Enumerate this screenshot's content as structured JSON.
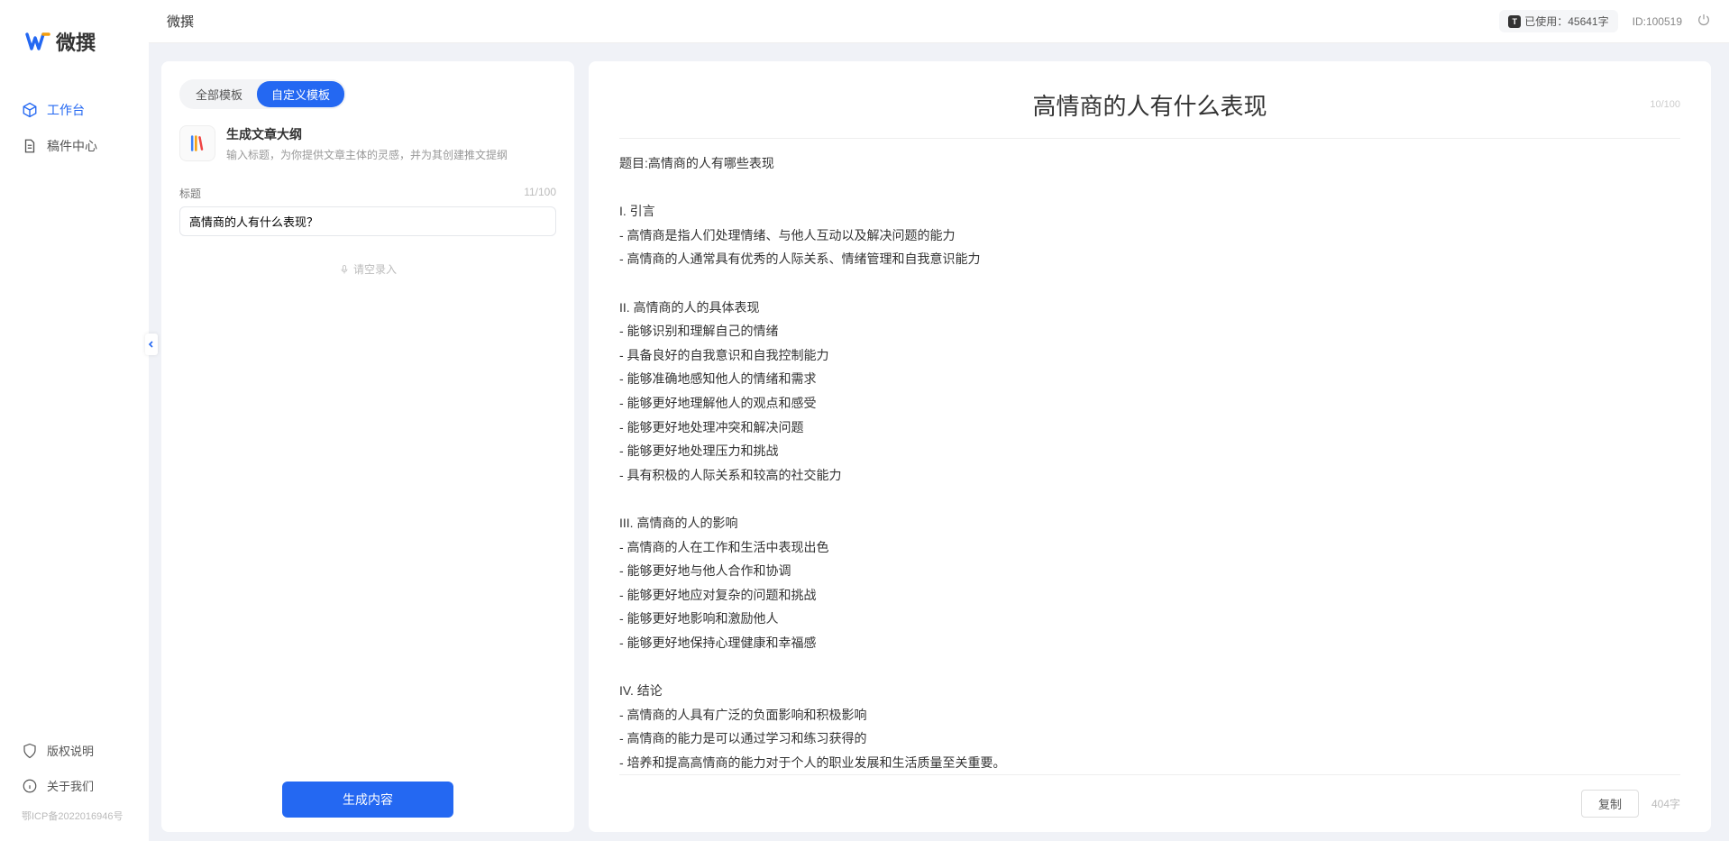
{
  "app_name": "微撰",
  "topbar": {
    "title": "微撰",
    "usage_label": "已使用：45641字",
    "id_label": "ID:100519"
  },
  "sidebar": {
    "items": [
      {
        "label": "工作台",
        "icon": "cube-icon",
        "active": true
      },
      {
        "label": "稿件中心",
        "icon": "document-icon",
        "active": false
      }
    ],
    "bottom": [
      {
        "label": "版权说明",
        "icon": "shield-icon"
      },
      {
        "label": "关于我们",
        "icon": "info-icon"
      }
    ],
    "icp": "鄂ICP备2022016946号"
  },
  "tabs": {
    "all": "全部模板",
    "custom": "自定义模板"
  },
  "template": {
    "title": "生成文章大纲",
    "desc": "输入标题，为你提供文章主体的灵感，并为其创建推文提纲"
  },
  "form": {
    "title_label": "标题",
    "title_count": "11/100",
    "title_value": "高情商的人有什么表现？",
    "voice_hint": "请空录入",
    "generate_btn": "生成内容"
  },
  "preview": {
    "title": "高情商的人有什么表现",
    "top_count": "10/100",
    "body": "题目:高情商的人有哪些表现\n\nI. 引言\n- 高情商是指人们处理情绪、与他人互动以及解决问题的能力\n- 高情商的人通常具有优秀的人际关系、情绪管理和自我意识能力\n\nII. 高情商的人的具体表现\n- 能够识别和理解自己的情绪\n- 具备良好的自我意识和自我控制能力\n- 能够准确地感知他人的情绪和需求\n- 能够更好地理解他人的观点和感受\n- 能够更好地处理冲突和解决问题\n- 能够更好地处理压力和挑战\n- 具有积极的人际关系和较高的社交能力\n\nIII. 高情商的人的影响\n- 高情商的人在工作和生活中表现出色\n- 能够更好地与他人合作和协调\n- 能够更好地应对复杂的问题和挑战\n- 能够更好地影响和激励他人\n- 能够更好地保持心理健康和幸福感\n\nIV. 结论\n- 高情商的人具有广泛的负面影响和积极影响\n- 高情商的能力是可以通过学习和练习获得的\n- 培养和提高高情商的能力对于个人的职业发展和生活质量至关重要。",
    "copy_btn": "复制",
    "char_count": "404字"
  }
}
